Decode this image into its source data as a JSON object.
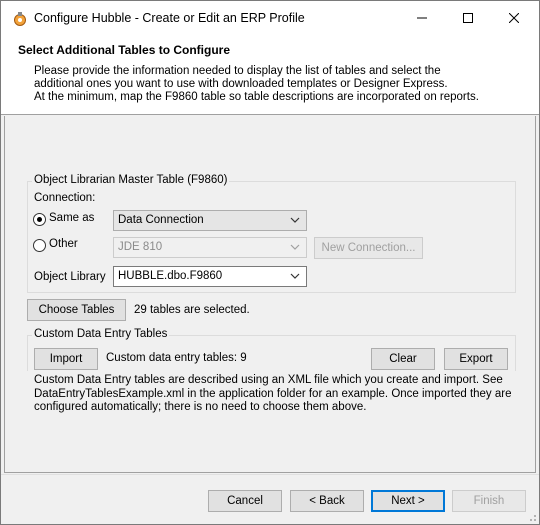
{
  "window": {
    "title": "Configure Hubble - Create or Edit an ERP Profile",
    "icon": "hubble-app-icon"
  },
  "header": {
    "title": "Select Additional Tables to Configure",
    "description": [
      "Please provide the information needed to display the list of tables and select the",
      "additional ones you want to use with downloaded templates or Designer Express.",
      "At the minimum, map the F9860 table so table descriptions are incorporated on reports."
    ]
  },
  "olm": {
    "group_label": "Object Librarian Master Table (F9860)",
    "connection_label": "Connection:",
    "same_as_label": "Same as",
    "same_as_checked": true,
    "same_as_value": "Data Connection",
    "other_label": "Other",
    "other_checked": false,
    "other_value": "JDE 810",
    "new_connection_label": "New Connection...",
    "object_library_label": "Object Library",
    "object_library_value": "HUBBLE.dbo.F9860"
  },
  "tables": {
    "choose_label": "Choose Tables",
    "status": "29 tables are selected."
  },
  "custom": {
    "group_label": "Custom Data Entry Tables",
    "import_label": "Import",
    "count_text": "Custom data entry tables: 9",
    "clear_label": "Clear",
    "export_label": "Export",
    "note": [
      "Custom Data Entry tables are described using an XML file which you create and import. See",
      "DataEntryTablesExample.xml in the application folder for an example. Once imported they are",
      "configured automatically; there is no need to choose them above."
    ]
  },
  "footer": {
    "cancel_label": "Cancel",
    "back_label": "< Back",
    "next_label": "Next >",
    "finish_label": "Finish"
  },
  "colors": {
    "accent": "#0078d7",
    "face": "#f0f0f0",
    "button": "#e1e1e1"
  }
}
